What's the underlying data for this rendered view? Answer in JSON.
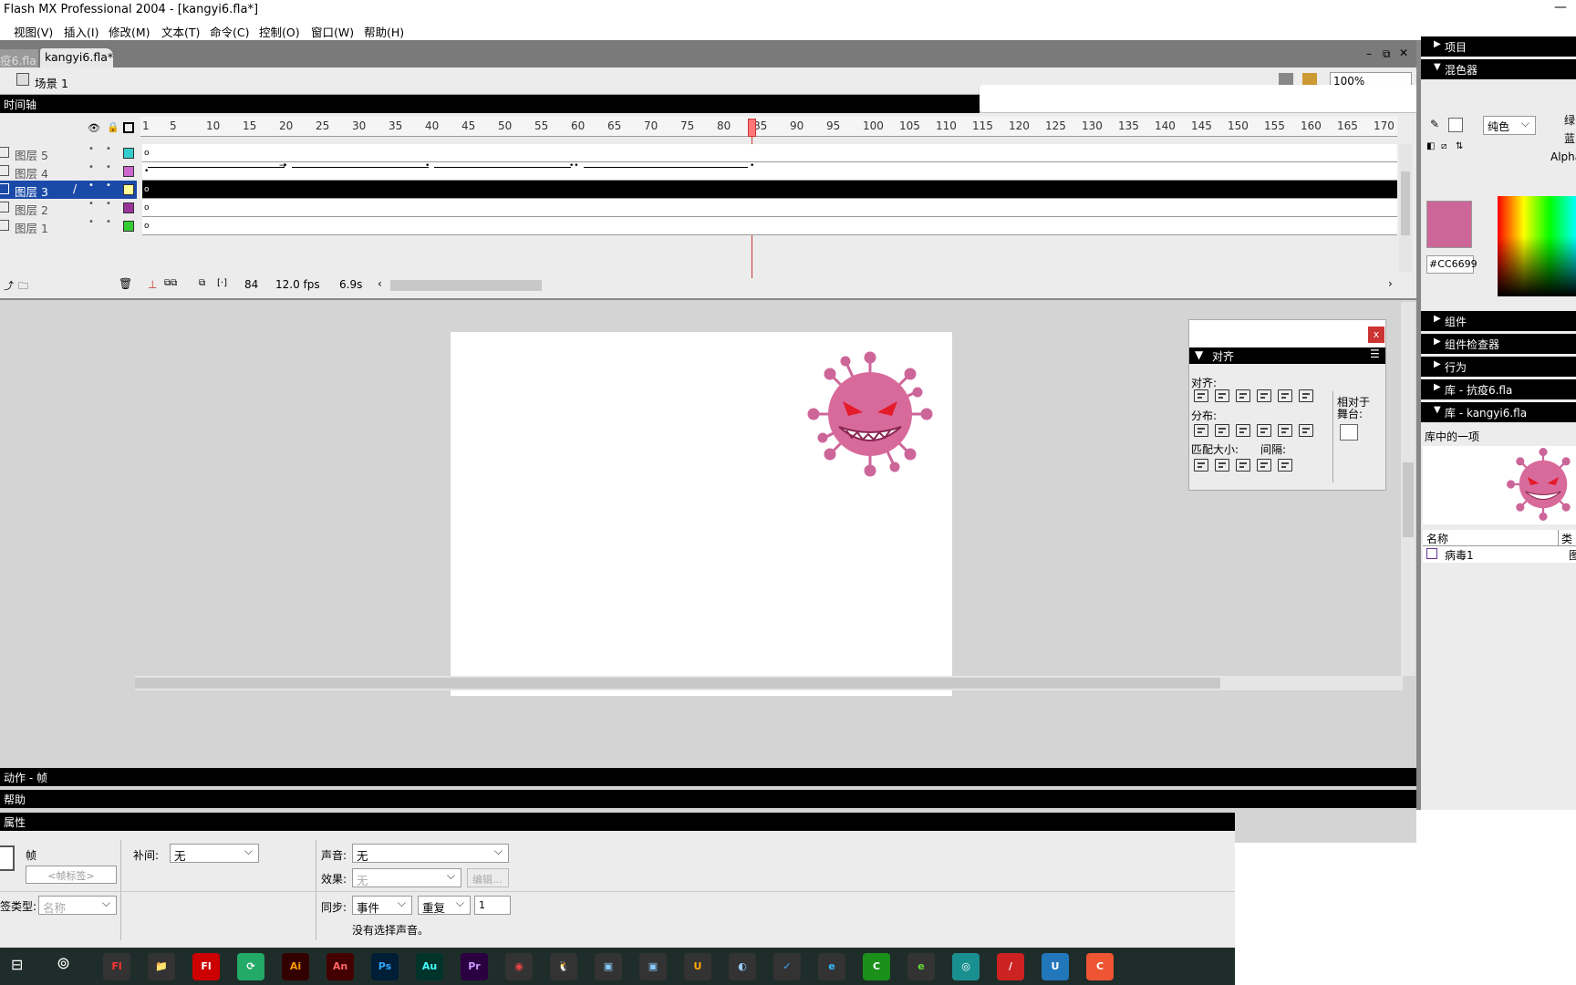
{
  "window": {
    "title": "Flash MX Professional 2004 - [kangyi6.fla*]"
  },
  "menu": [
    {
      "label": "视图(V)"
    },
    {
      "label": "插入(I)"
    },
    {
      "label": "修改(M)"
    },
    {
      "label": "文本(T)"
    },
    {
      "label": "命令(C)"
    },
    {
      "label": "控制(O)"
    },
    {
      "label": "窗口(W)"
    },
    {
      "label": "帮助(H)"
    }
  ],
  "tabs": {
    "inactive": "疫6.fla",
    "active": "kangyi6.fla*"
  },
  "scene": {
    "label": "场景 1",
    "zoom": "100%"
  },
  "timeline": {
    "title": "时间轴",
    "ruler": [
      "1",
      "5",
      "10",
      "15",
      "20",
      "25",
      "30",
      "35",
      "40",
      "45",
      "50",
      "55",
      "60",
      "65",
      "70",
      "75",
      "80",
      "85",
      "90",
      "95",
      "100",
      "105",
      "110",
      "115",
      "120",
      "125",
      "130",
      "135",
      "140",
      "145",
      "150",
      "155",
      "160",
      "165",
      "170"
    ],
    "layers": [
      {
        "name": "图层 5",
        "color": "#33CCCC",
        "selected": false
      },
      {
        "name": "图层 4",
        "color": "#CC66CC",
        "selected": false
      },
      {
        "name": "图层 3",
        "color": "#FFFF99",
        "selected": true
      },
      {
        "name": "图层 2",
        "color": "#993399",
        "selected": false
      },
      {
        "name": "图层 1",
        "color": "#33CC33",
        "selected": false
      }
    ],
    "current_frame": "84",
    "fps": "12.0 fps",
    "elapsed": "6.9s"
  },
  "align_panel": {
    "title": "对齐",
    "align_label": "对齐:",
    "distribute_label": "分布:",
    "match_label": "匹配大小:",
    "spacing_label": "间隔:",
    "relative_label": "相对于\n舞台:"
  },
  "right_panels": {
    "project": "项目",
    "mixer": "混色器",
    "fill_type": "纯色",
    "hex": "#CC6699",
    "channel_labels": [
      "绿",
      "蓝",
      "Alpha"
    ],
    "components": "组件",
    "comp_inspector": "组件检查器",
    "behaviors": "行为",
    "lib1": "库 - 抗疫6.fla",
    "lib2": "库 - kangyi6.fla",
    "lib_count": "库中的一项",
    "lib_col_name": "名称",
    "lib_col_type": "类型",
    "lib_item": "病毒1",
    "lib_item_type": "图"
  },
  "bottom_panels": {
    "actions": "动作 - 帧",
    "help": "帮助",
    "props": "属性"
  },
  "properties": {
    "frame_label": "帧",
    "frame_placeholder": "<帧标签>",
    "label_type_label": "签类型:",
    "label_type_value": "名称",
    "tween_label": "补间:",
    "tween_value": "无",
    "sound_label": "声音:",
    "sound_value": "无",
    "effect_label": "效果:",
    "effect_value": "无",
    "edit_label": "编辑...",
    "sync_label": "同步:",
    "sync_value": "事件",
    "repeat_value": "重复",
    "repeat_count": "1",
    "no_sound": "没有选择声音。"
  },
  "taskbar": [
    {
      "label": "Fl",
      "bg": "#333",
      "fg": "#f33"
    },
    {
      "label": "📁",
      "bg": "#333",
      "fg": "#fc0"
    },
    {
      "label": "Fl",
      "bg": "#c00",
      "fg": "#fff"
    },
    {
      "label": "⟳",
      "bg": "#2a6",
      "fg": "#fff"
    },
    {
      "label": "Ai",
      "bg": "#330000",
      "fg": "#f90"
    },
    {
      "label": "An",
      "bg": "#400",
      "fg": "#f66"
    },
    {
      "label": "Ps",
      "bg": "#001e36",
      "fg": "#31a8ff"
    },
    {
      "label": "Au",
      "bg": "#00332a",
      "fg": "#4ff"
    },
    {
      "label": "Pr",
      "bg": "#2a0040",
      "fg": "#c9f"
    },
    {
      "label": "◉",
      "bg": "#333",
      "fg": "#e44"
    },
    {
      "label": "🐧",
      "bg": "#333",
      "fg": "#fff"
    },
    {
      "label": "▣",
      "bg": "#333",
      "fg": "#8cf"
    },
    {
      "label": "▣",
      "bg": "#333",
      "fg": "#8cf"
    },
    {
      "label": "U",
      "bg": "#333",
      "fg": "#fa0"
    },
    {
      "label": "◐",
      "bg": "#333",
      "fg": "#9cf"
    },
    {
      "label": "✓",
      "bg": "#333",
      "fg": "#4af"
    },
    {
      "label": "e",
      "bg": "#333",
      "fg": "#3bf"
    },
    {
      "label": "C",
      "bg": "#1a8f1a",
      "fg": "#fff"
    },
    {
      "label": "e",
      "bg": "#333",
      "fg": "#6d3"
    },
    {
      "label": "◎",
      "bg": "#1a8f8f",
      "fg": "#fff"
    },
    {
      "label": "/",
      "bg": "#c22",
      "fg": "#fff"
    },
    {
      "label": "U",
      "bg": "#27b",
      "fg": "#fff"
    },
    {
      "label": "C",
      "bg": "#e53",
      "fg": "#fff"
    }
  ]
}
